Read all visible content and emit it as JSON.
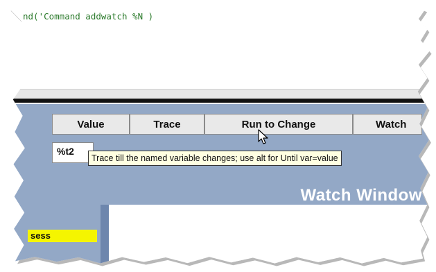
{
  "editor": {
    "code_line": "nd('Command addwatch %N )"
  },
  "toolbar": {
    "buttons": [
      {
        "label": "Value"
      },
      {
        "label": "Trace"
      },
      {
        "label": "Run to Change"
      },
      {
        "label": "Watch"
      }
    ]
  },
  "watch": {
    "variable_value": "%t2",
    "tooltip": "Trace till the named variable changes; use alt for Until var=value",
    "title": "Watch Window"
  },
  "sidebar": {
    "session_label": "sess"
  },
  "colors": {
    "panel_blue": "#93a8c6",
    "divider_blue": "#6d86ad",
    "tooltip_bg": "#ffffe1",
    "highlight_yellow": "#f5f500",
    "code_green": "#2b7a2b"
  },
  "icons": {
    "pointer": "mouse-pointer-icon"
  }
}
